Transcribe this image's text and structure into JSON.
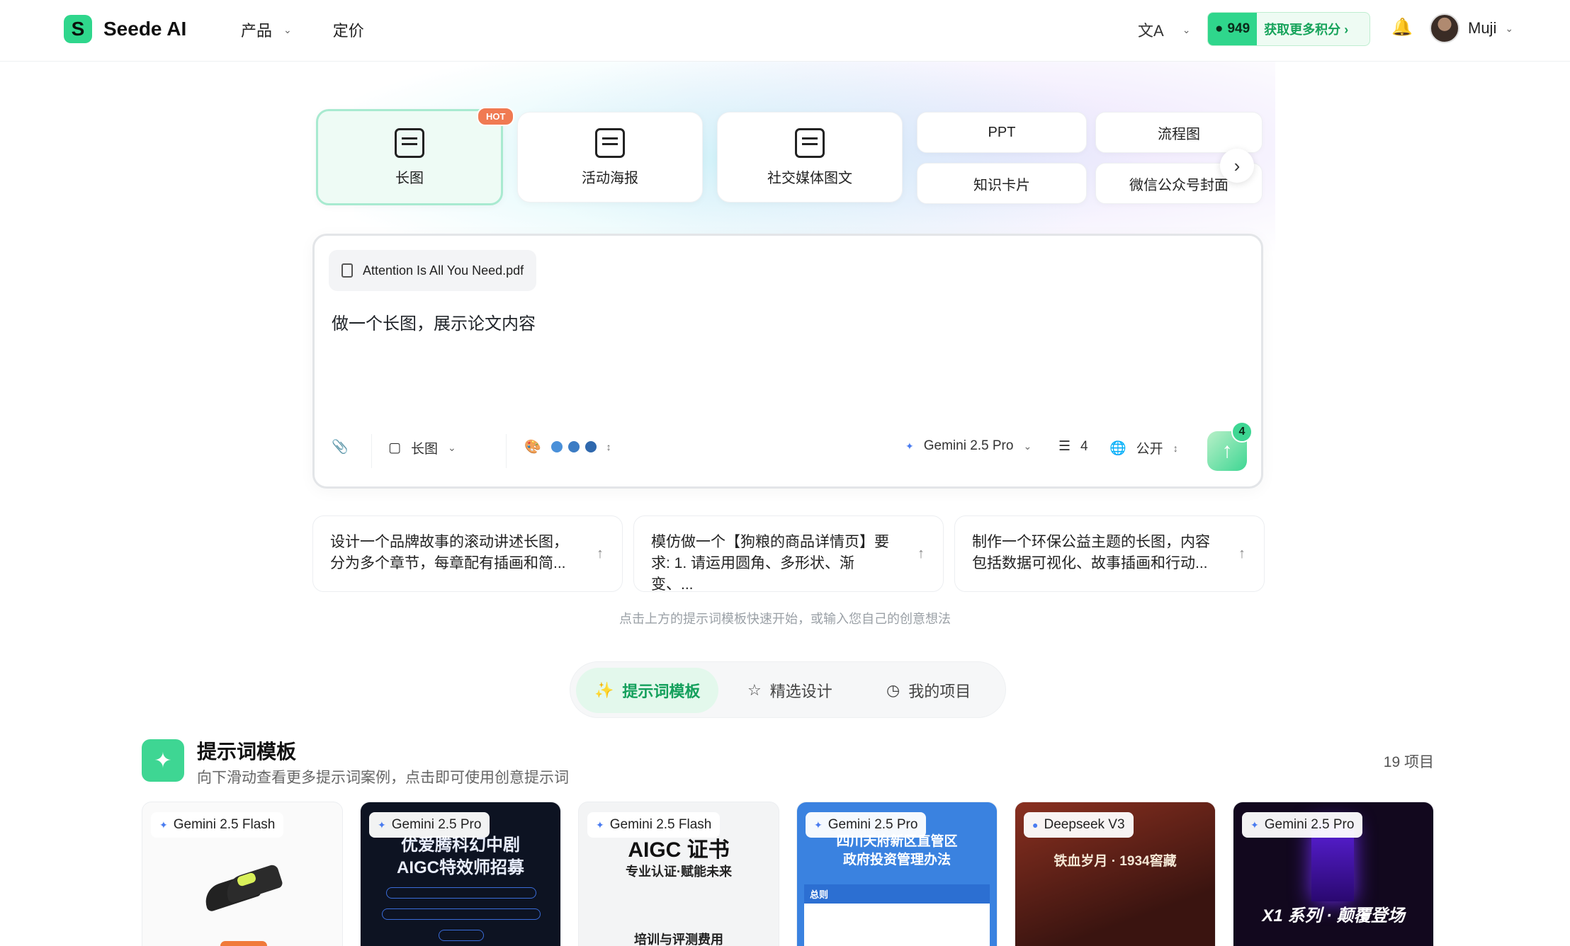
{
  "header": {
    "brand": "Seede AI",
    "nav": [
      {
        "label": "产品",
        "has_dropdown": true
      },
      {
        "label": "定价",
        "has_dropdown": false
      }
    ],
    "lang_icon": "translate-icon",
    "credits": {
      "count": "949",
      "cta": "获取更多积分"
    },
    "user": {
      "name": "Muji"
    }
  },
  "categories": {
    "cards": [
      {
        "label": "长图",
        "icon": "long-image-icon",
        "active": true,
        "badge": "HOT"
      },
      {
        "label": "活动海报",
        "icon": "poster-icon",
        "active": false
      },
      {
        "label": "社交媒体图文",
        "icon": "social-post-icon",
        "active": false
      }
    ],
    "pills": [
      "PPT",
      "流程图",
      "知识卡片",
      "微信公众号封面"
    ]
  },
  "composer": {
    "attachment": "Attention Is All You Need.pdf",
    "prompt": "做一个长图，展示论文内容",
    "format": "长图",
    "palette": [
      "#4a90d9",
      "#3c7cc4",
      "#2f68ad"
    ],
    "model": "Gemini 2.5 Pro",
    "count": "4",
    "visibility": "公开",
    "send_badge": "4",
    "colors": {
      "accent": "#3ed693"
    }
  },
  "suggestions": [
    {
      "line1": "设计一个品牌故事的滚动讲述长图，",
      "line2": "分为多个章节，每章配有插画和简..."
    },
    {
      "line1": "模仿做一个【狗粮的商品详情页】要",
      "line2": "求: 1. 请运用圆角、多形状、渐变、..."
    },
    {
      "line1": "制作一个环保公益主题的长图，内容",
      "line2": "包括数据可视化、故事插画和行动..."
    }
  ],
  "hint": "点击上方的提示词模板快速开始，或输入您自己的创意想法",
  "tabs": [
    {
      "label": "提示词模板",
      "active": true
    },
    {
      "label": "精选设计",
      "active": false
    },
    {
      "label": "我的项目",
      "active": false
    }
  ],
  "section": {
    "title": "提示词模板",
    "subtitle": "向下滑动查看更多提示词案例，点击即可使用创意提示词",
    "count": "19 项目"
  },
  "templates": [
    {
      "model": "Gemini 2.5 Flash",
      "title": "",
      "sub": ""
    },
    {
      "model": "Gemini 2.5 Pro",
      "title": "优爱腾科幻中剧",
      "sub": "AIGC特效师招募"
    },
    {
      "model": "Gemini 2.5 Flash",
      "title": "AIGC 证书",
      "sub": "专业认证·赋能未来",
      "foot": "培训与评测费用"
    },
    {
      "model": "Gemini 2.5 Pro",
      "title": "四川天府新区直管区",
      "sub": "政府投资管理办法",
      "foot": "总则"
    },
    {
      "model": "Deepseek V3",
      "title": "铁血岁月 · 1934窖藏",
      "sub": ""
    },
    {
      "model": "Gemini 2.5 Pro",
      "title": "X1 系列 · 颠覆登场",
      "sub": ""
    }
  ]
}
